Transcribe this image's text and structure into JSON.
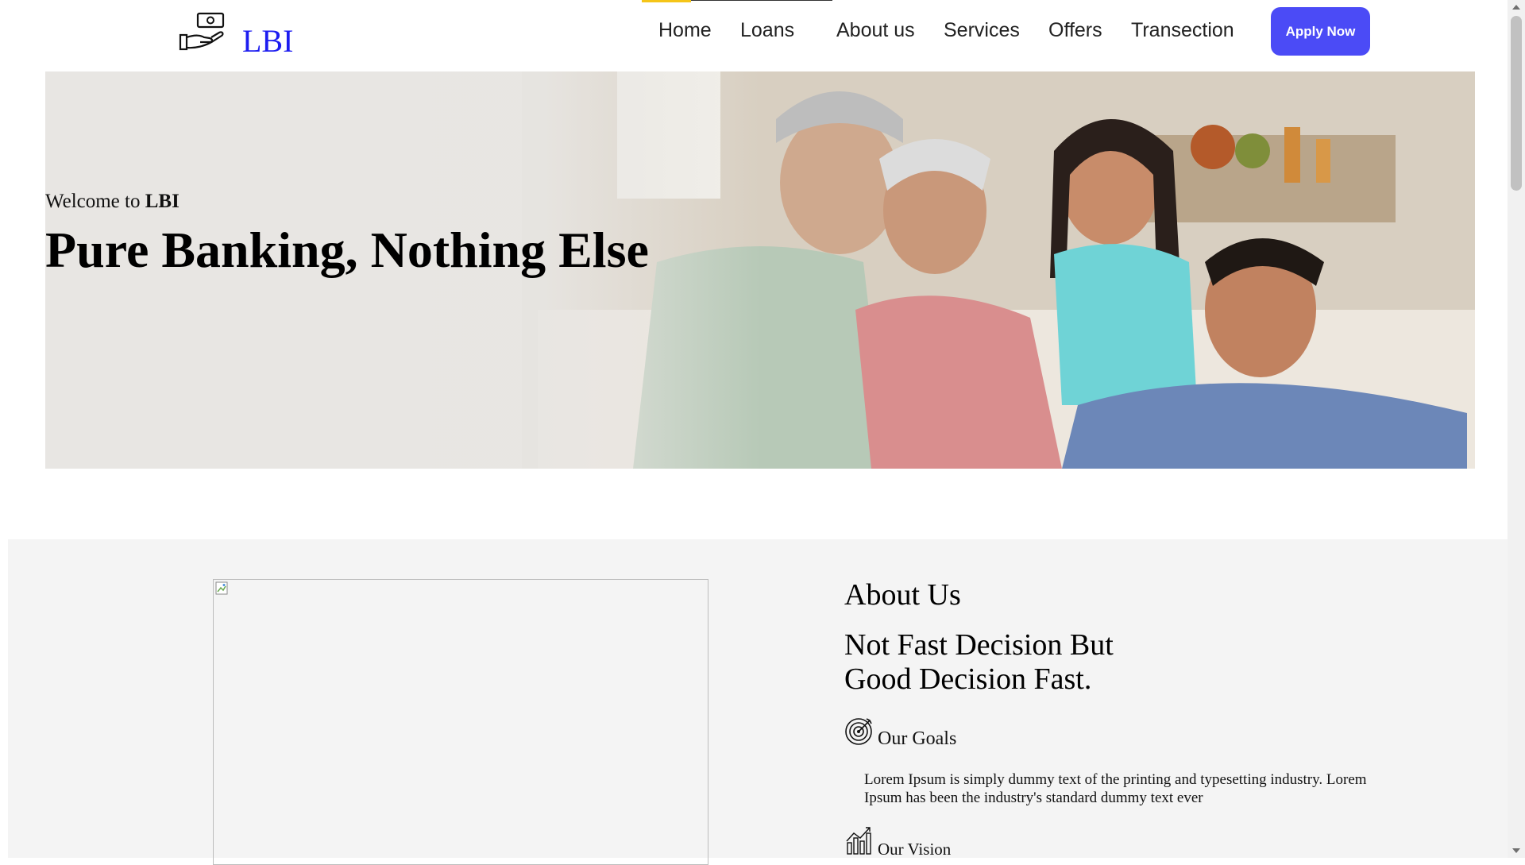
{
  "brand": {
    "name": "LBI",
    "logo_icon": "hand-money-icon",
    "color": "#1d1df0"
  },
  "nav": {
    "items": [
      "Home",
      "Loans",
      "About us",
      "Services",
      "Offers",
      "Transection"
    ],
    "active": "Home",
    "indicator_color": "#f5c518",
    "apply_label": "Apply Now",
    "apply_color": "#4b4bf6"
  },
  "hero": {
    "welcome_prefix": "Welcome to ",
    "welcome_brand": "LBI",
    "title": "Pure Banking, Nothing Else"
  },
  "about": {
    "label": "About Us",
    "heading_line1": "Not Fast Decision But",
    "heading_line2": "Good Decision Fast.",
    "goals": {
      "icon": "target-icon",
      "title": "Our Goals",
      "text": "Lorem Ipsum is simply dummy text of the printing and typesetting industry. Lorem Ipsum has been the industry's standard dummy text ever"
    },
    "vision": {
      "icon": "chart-growth-icon",
      "title": "Our Vision"
    }
  }
}
